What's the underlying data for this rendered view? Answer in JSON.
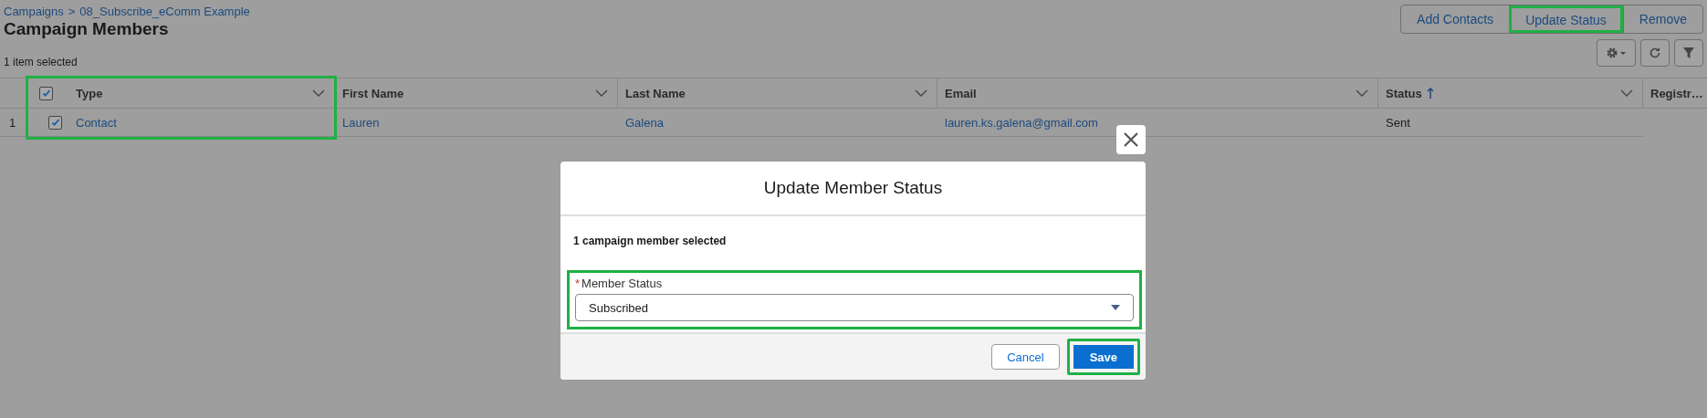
{
  "breadcrumb": {
    "parent": "Campaigns",
    "separator": ">",
    "current": "08_Subscribe_eComm Example"
  },
  "page_title": "Campaign Members",
  "selection_count": "1 item selected",
  "actions": [
    {
      "label": "Add Contacts",
      "highlighted": false
    },
    {
      "label": "Update Status",
      "highlighted": true
    },
    {
      "label": "Remove",
      "highlighted": false
    }
  ],
  "table": {
    "select_all_checked": true,
    "columns": [
      {
        "label": "Type",
        "highlighted": true,
        "sorted": false,
        "menu": true
      },
      {
        "label": "First Name",
        "highlighted": false,
        "sorted": false,
        "menu": true
      },
      {
        "label": "Last Name",
        "highlighted": false,
        "sorted": false,
        "menu": true
      },
      {
        "label": "Email",
        "highlighted": false,
        "sorted": false,
        "menu": true
      },
      {
        "label": "Status",
        "highlighted": false,
        "sorted": true,
        "menu": true
      },
      {
        "label": "Registr…",
        "highlighted": false
      }
    ],
    "rows": [
      {
        "number": "1",
        "checked": true,
        "cells": [
          {
            "text": "Contact",
            "kind": "link"
          },
          {
            "text": "Lauren",
            "kind": "link"
          },
          {
            "text": "Galena",
            "kind": "link"
          },
          {
            "text": "lauren.ks.galena@gmail.com",
            "kind": "link"
          },
          {
            "text": "Sent",
            "kind": "text"
          }
        ]
      }
    ]
  },
  "modal": {
    "title": "Update Member Status",
    "message": "1 campaign member selected",
    "field": {
      "label": "Member Status",
      "required_mark": "*",
      "value": "Subscribed",
      "highlighted": true
    },
    "buttons": [
      {
        "label": "Cancel",
        "kind": "neutral",
        "highlighted": false
      },
      {
        "label": "Save",
        "kind": "brand",
        "highlighted": true
      }
    ]
  }
}
